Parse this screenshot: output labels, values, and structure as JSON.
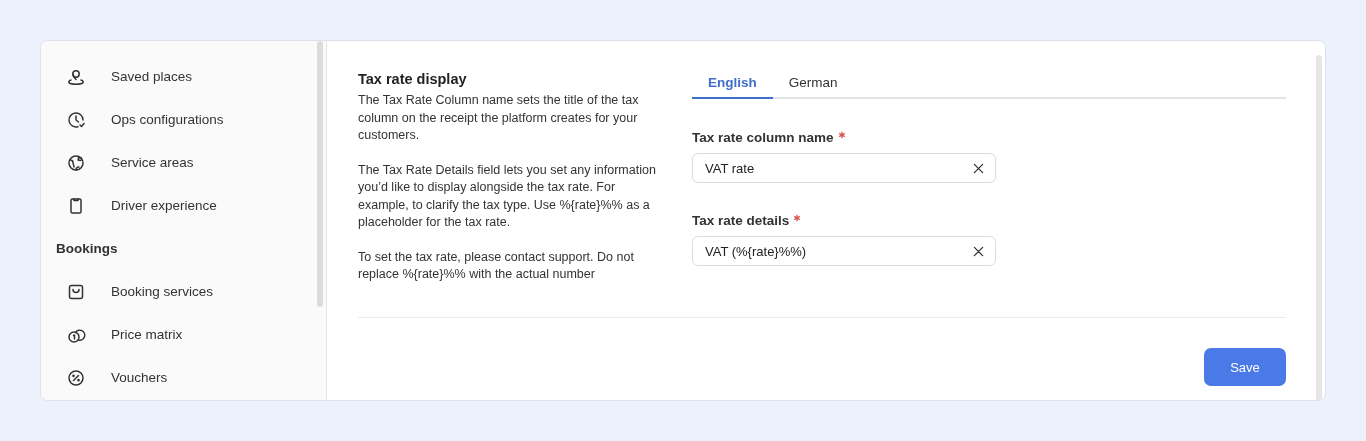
{
  "sidebar": {
    "items": [
      {
        "kind": "item",
        "label": "Saved places"
      },
      {
        "kind": "item",
        "label": "Ops configurations"
      },
      {
        "kind": "item",
        "label": "Service areas"
      },
      {
        "kind": "item",
        "label": "Driver experience"
      },
      {
        "kind": "heading",
        "label": "Bookings"
      },
      {
        "kind": "item",
        "label": "Booking services"
      },
      {
        "kind": "item",
        "label": "Price matrix"
      },
      {
        "kind": "item",
        "label": "Vouchers"
      }
    ]
  },
  "section": {
    "title": "Tax rate display",
    "paragraphs": [
      "The Tax Rate Column name sets the title of the tax column on the receipt the platform creates for your customers.",
      "The Tax Rate Details field lets you set any information you’d like to display alongside the tax rate. For example, to clarify the tax type. Use %{rate}%% as a placeholder for the tax rate.",
      "To set the tax rate, please contact support. Do not replace %{rate}%% with the actual number"
    ]
  },
  "tabs": [
    {
      "label": "English",
      "selected": true
    },
    {
      "label": "German",
      "selected": false
    }
  ],
  "fields": [
    {
      "label": "Tax rate column name",
      "required": true,
      "value": "VAT rate"
    },
    {
      "label": "Tax rate details",
      "required": true,
      "value": "VAT (%{rate}%%)"
    }
  ],
  "buttons": [
    {
      "label": "Save"
    }
  ]
}
